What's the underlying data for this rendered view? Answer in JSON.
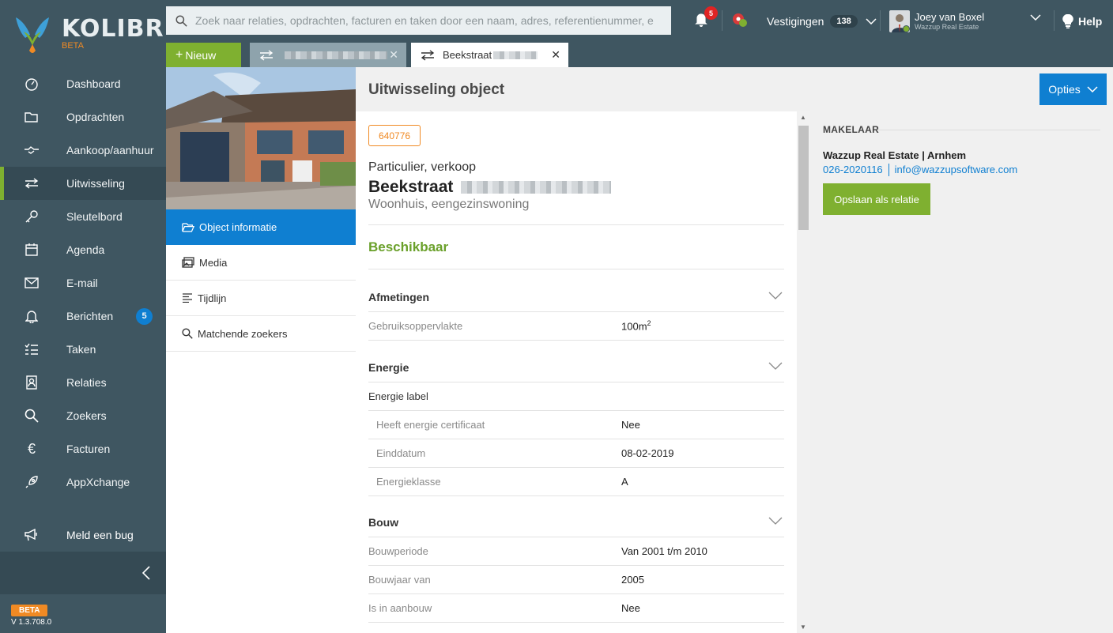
{
  "app": {
    "logo_text": "KOLIBRI",
    "logo_sub": "BETA",
    "beta_tag": "BETA",
    "version": "V 1.3.708.0"
  },
  "sidebar": {
    "items": [
      {
        "label": "Dashboard",
        "icon": "dashboard-icon"
      },
      {
        "label": "Opdrachten",
        "icon": "folder-icon"
      },
      {
        "label": "Aankoop/aanhuur",
        "icon": "handshake-icon"
      },
      {
        "label": "Uitwisseling",
        "icon": "exchange-icon",
        "active": true
      },
      {
        "label": "Sleutelbord",
        "icon": "key-icon"
      },
      {
        "label": "Agenda",
        "icon": "calendar-icon"
      },
      {
        "label": "E-mail",
        "icon": "mail-icon"
      },
      {
        "label": "Berichten",
        "icon": "bell-icon",
        "badge": "5"
      },
      {
        "label": "Taken",
        "icon": "tasks-icon"
      },
      {
        "label": "Relaties",
        "icon": "contacts-icon"
      },
      {
        "label": "Zoekers",
        "icon": "search-icon"
      },
      {
        "label": "Facturen",
        "icon": "euro-icon"
      },
      {
        "label": "AppXchange",
        "icon": "rocket-icon"
      }
    ],
    "bug_label": "Meld een bug"
  },
  "topbar": {
    "search_placeholder": "Zoek naar relaties, opdrachten, facturen en taken door een naam, adres, referentienummer, e",
    "notifications_count": "5",
    "vestigingen_label": "Vestigingen",
    "vestigingen_count": "138",
    "user_name": "Joey van Boxel",
    "user_company": "Wazzup Real Estate",
    "help_label": "Help"
  },
  "tabs": {
    "new_label": "Nieuw",
    "active_tab_label": "Beekstraat"
  },
  "objnav": {
    "items": [
      {
        "label": "Object informatie",
        "icon": "folder-open-icon"
      },
      {
        "label": "Media",
        "icon": "images-icon"
      },
      {
        "label": "Tijdlijn",
        "icon": "timeline-icon"
      },
      {
        "label": "Matchende zoekers",
        "icon": "search-icon"
      }
    ]
  },
  "page": {
    "title": "Uitwisseling object",
    "options_label": "Opties"
  },
  "object": {
    "id": "640776",
    "subtype": "Particulier, verkoop",
    "street": "Beekstraat",
    "kind": "Woonhuis, eengezinswoning",
    "status": "Beschikbaar"
  },
  "sections": {
    "afmetingen": {
      "title": "Afmetingen",
      "rows": [
        {
          "label": "Gebruiksoppervlakte",
          "value": "100m",
          "sup": "2"
        }
      ]
    },
    "energie": {
      "title": "Energie",
      "sub_title": "Energie label",
      "rows": [
        {
          "label": "Heeft energie certificaat",
          "value": "Nee"
        },
        {
          "label": "Einddatum",
          "value": "08-02-2019"
        },
        {
          "label": "Energieklasse",
          "value": "A"
        }
      ]
    },
    "bouw": {
      "title": "Bouw",
      "rows": [
        {
          "label": "Bouwperiode",
          "value": "Van 2001 t/m 2010"
        },
        {
          "label": "Bouwjaar van",
          "value": "2005"
        },
        {
          "label": "Is in aanbouw",
          "value": "Nee"
        }
      ]
    }
  },
  "makelaar": {
    "heading": "MAKELAAR",
    "org": "Wazzup Real Estate | Arnhem",
    "phone": "026-2020116",
    "email": "info@wazzupsoftware.com",
    "save_label": "Opslaan als relatie"
  },
  "colors": {
    "sidebar_bg": "#3f5661",
    "accent_green": "#7fb030",
    "accent_blue": "#0f7fd1",
    "accent_orange": "#f08a24"
  }
}
